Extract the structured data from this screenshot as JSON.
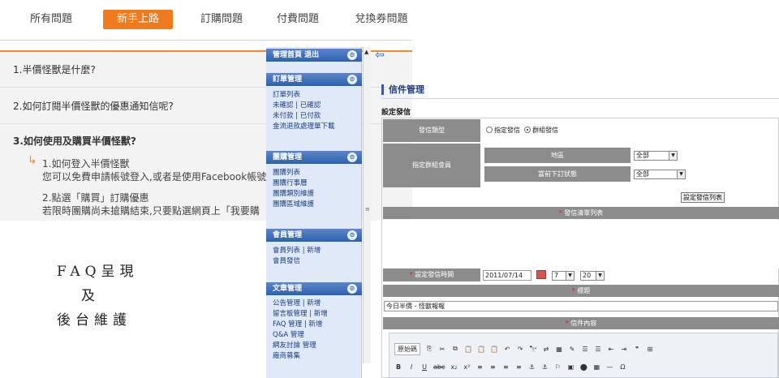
{
  "faq": {
    "tabs": [
      {
        "label": "所有問題"
      },
      {
        "label": "新手上路"
      },
      {
        "label": "訂購問題"
      },
      {
        "label": "付費問題"
      },
      {
        "label": "兌換券問題"
      }
    ],
    "questions": [
      "1.半價怪獸是什麼?",
      "2.如何訂閱半價怪獸的優惠通知信呢?",
      "3.如何使用及購買半價怪獸?"
    ],
    "answer": {
      "arrow": "↳",
      "line1": "1.如何登入半價怪獸",
      "line2": "您可以免費申請帳號登入,或者是使用Facebook帳號",
      "line3": "2.點選「購買」訂購優惠",
      "line4": "若限時團購尚未搶購結束,只要點選網頁上「我要購"
    }
  },
  "annotation": {
    "line1": "FAQ呈現",
    "line2": "及",
    "line3": "後台維護"
  },
  "sidebar": {
    "groups": [
      {
        "header": "管理首頁 退出",
        "items": []
      },
      {
        "header": "訂單管理",
        "items": [
          "訂單列表",
          "未確認 | 已確認",
          "未付款 | 已付款",
          "金流退款處理單下載"
        ]
      },
      {
        "header": "團購管理",
        "items": [
          "團購列表",
          "團購行事曆",
          "團購類別維護",
          "團購區域維護"
        ]
      },
      {
        "header": "會員管理",
        "items": [
          "會員列表 | 新增",
          "會員發信"
        ]
      },
      {
        "header": "文章管理",
        "items": [
          "公告管理 | 新增",
          "留言板管理 | 新增",
          "FAQ 管理 | 新增",
          "Q&A 管理",
          "網友討論 管理",
          "廠商募集"
        ]
      }
    ],
    "toggle_icon": "⊙"
  },
  "panel": {
    "back_icon": "⇦",
    "title": "信件管理",
    "section": "設定發信",
    "form": {
      "mail_type_label": "發信類型",
      "mail_type_options": [
        "指定發信",
        "群組發信"
      ],
      "group_label": "指定群組會員",
      "region_label": "地區",
      "region_value": "全部",
      "order_status_label": "當前下訂狀態",
      "order_status_value": "全部",
      "set_list_button": "設定發信列表",
      "list_bar": "發信清單列表",
      "time_label": "設定發信時間",
      "date_value": "2011/07/14",
      "hour_value": "7",
      "minute_value": "20",
      "subject_bar": "標題",
      "subject_value": "今日半價 - 怪獸報報",
      "content_bar": "信件內容",
      "req_mark": "*"
    },
    "toolbar": {
      "row1": [
        "原始碼",
        "⎘",
        "✂",
        "⧉",
        "📋",
        "📋",
        "📋",
        "↶",
        "↷",
        "🔭",
        "⇄",
        "▦",
        "✎",
        "☰",
        "☰",
        "⇤",
        "⇥",
        "❞",
        "⊞"
      ],
      "row2": [
        "B",
        "I",
        "U",
        "abc",
        "x₂",
        "x²",
        "≡",
        "≡",
        "≡",
        "≡",
        "⚓",
        "⚓",
        "⚐",
        "▣",
        "⬤",
        "▦",
        "—",
        "Ω"
      ]
    }
  }
}
